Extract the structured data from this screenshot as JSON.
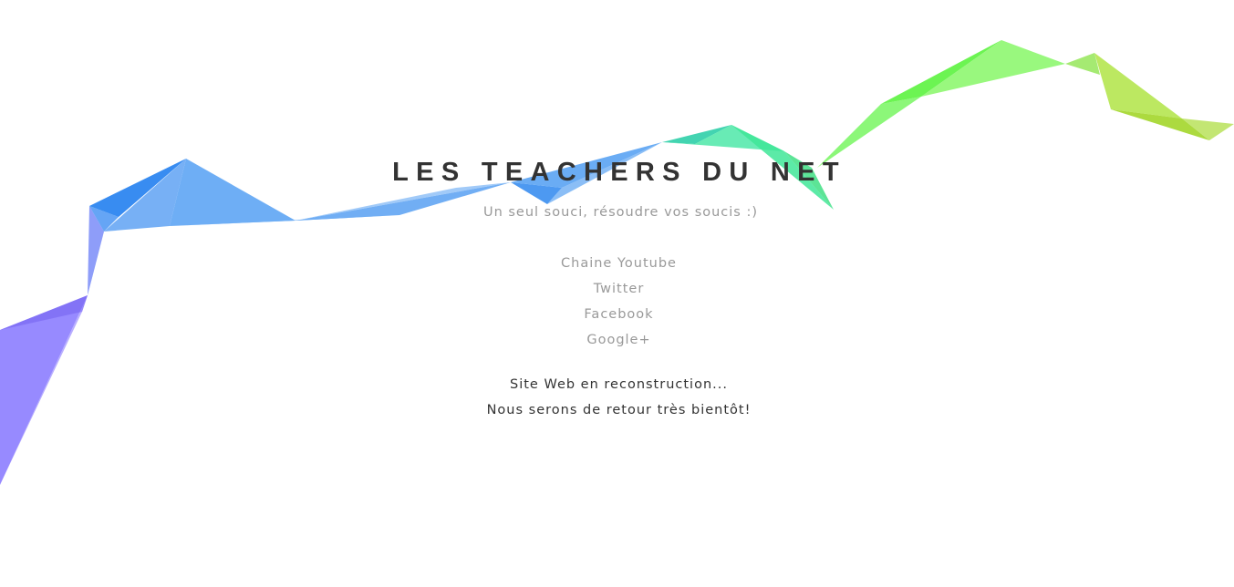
{
  "header": {
    "title": "LES TEACHERS DU NET",
    "subtitle": "Un seul souci, résoudre vos soucis :)"
  },
  "links": [
    {
      "label": "Chaine Youtube"
    },
    {
      "label": "Twitter"
    },
    {
      "label": "Facebook"
    },
    {
      "label": "Google+"
    }
  ],
  "notice": {
    "line1": "Site Web en reconstruction...",
    "line2": "Nous serons de retour très bientôt!"
  },
  "colors": {
    "title": "#333333",
    "muted": "#999999",
    "ribbon_purple": "#8c7dff",
    "ribbon_blue": "#3d8ff2",
    "ribbon_teal": "#36e695",
    "ribbon_green": "#6cf552",
    "ribbon_lime": "#b6e33c"
  }
}
